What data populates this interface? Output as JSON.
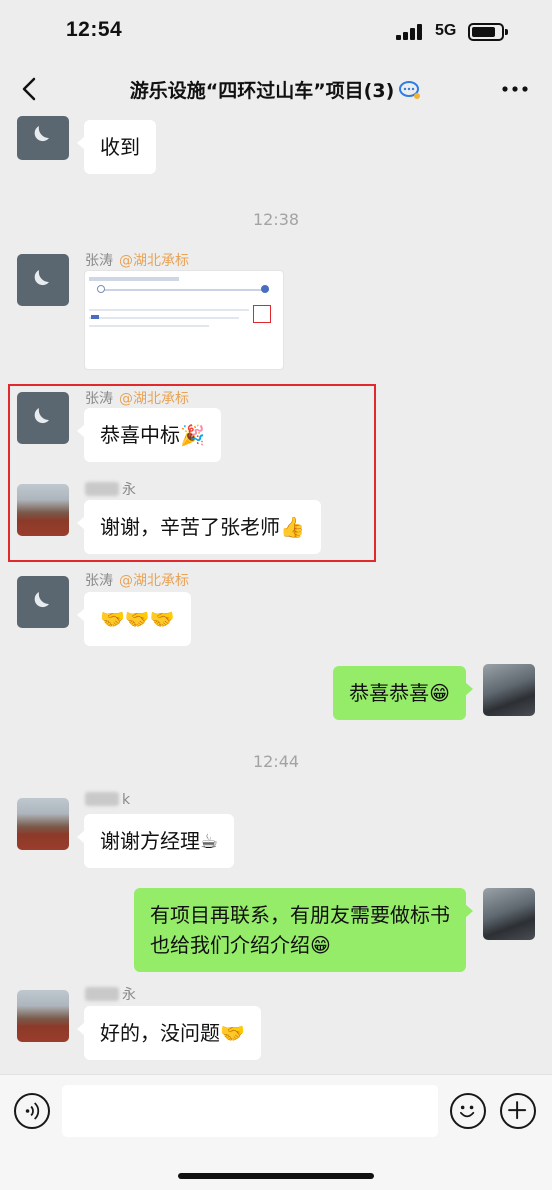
{
  "status_bar": {
    "time": "12:54",
    "network": "5G"
  },
  "nav": {
    "title": "游乐设施“四环过山车”项目(3)"
  },
  "timestamps": [
    "12:38",
    "12:44"
  ],
  "messages": [
    {
      "text": "收到"
    },
    {
      "sender": "张涛",
      "tag": "@湖北承标"
    },
    {
      "sender": "张涛",
      "tag": "@湖北承标",
      "text": "恭喜中标🎉"
    },
    {
      "sender": "永",
      "text": "谢谢，辛苦了张老师👍"
    },
    {
      "sender": "张涛",
      "tag": "@湖北承标",
      "text": "🤝🤝🤝"
    },
    {
      "text": "恭喜恭喜😁"
    },
    {
      "sender": "k",
      "text": "谢谢方经理☕"
    },
    {
      "line1": "有项目再联系，有朋友需要做标书",
      "line2": "也给我们介绍介绍😁"
    },
    {
      "sender": "永",
      "text": "好的，没问题🤝"
    }
  ],
  "icons": {
    "back": "back-arrow-icon",
    "more": "more-dots-icon",
    "voice": "voice-icon",
    "emoji": "emoji-icon",
    "plus": "plus-icon"
  },
  "colors": {
    "background": "#ededed",
    "bubble_self": "#95ec69",
    "tag": "#e8a356",
    "highlight": "#e0282d"
  }
}
